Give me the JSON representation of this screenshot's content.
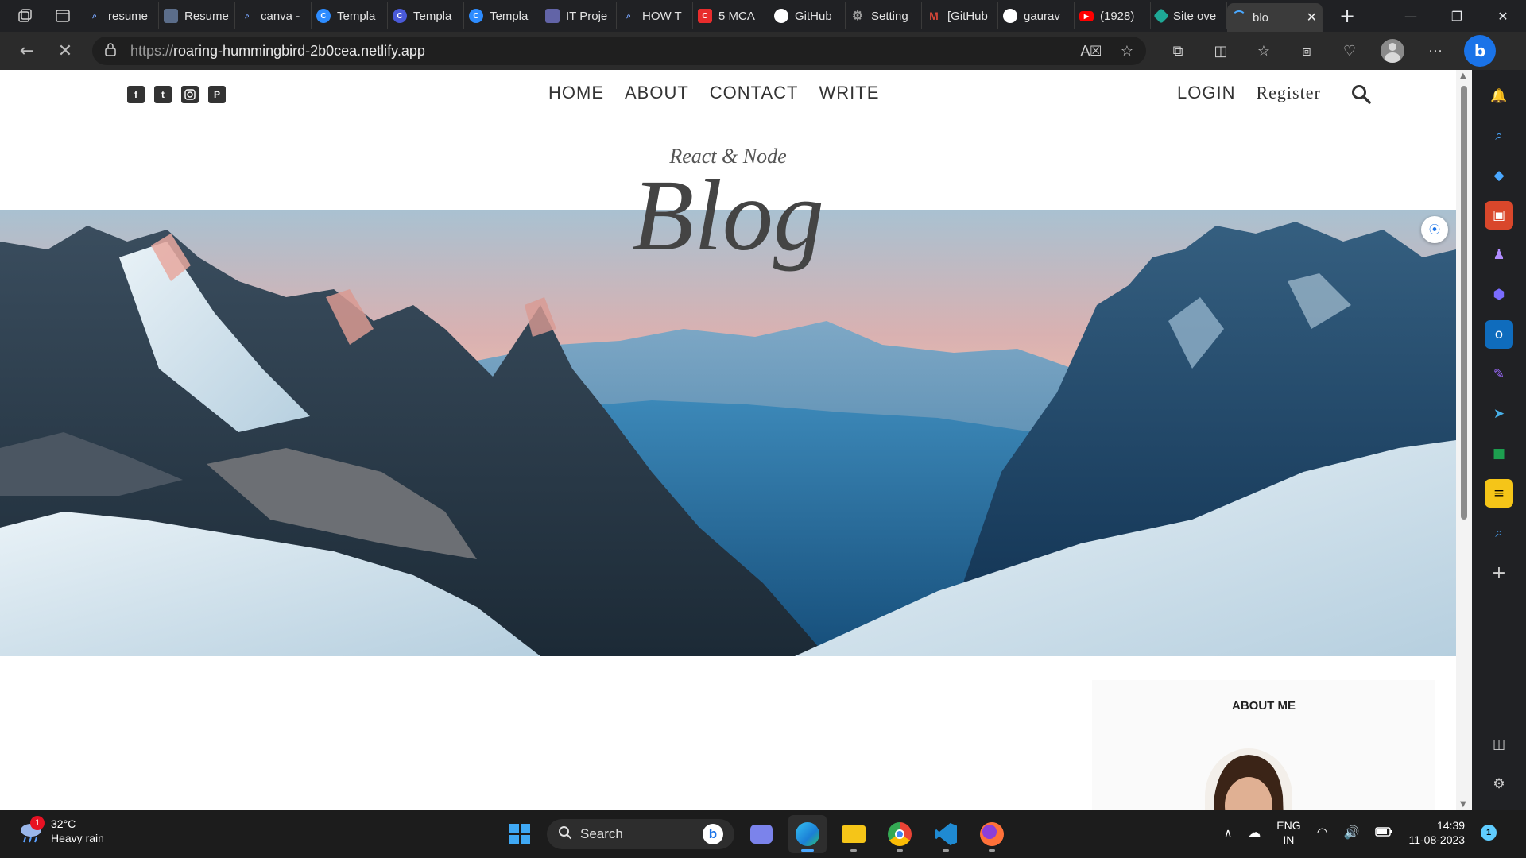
{
  "browser": {
    "tabs": [
      {
        "label": "resume",
        "icon": "search-icon",
        "color": "#3b3b3b"
      },
      {
        "label": "Resume",
        "icon": "document-icon",
        "color": "#5b6d8a"
      },
      {
        "label": "canva -",
        "icon": "search-icon",
        "color": "#3b3b3b"
      },
      {
        "label": "Templa",
        "icon": "canva-icon",
        "color": "#2d8cff"
      },
      {
        "label": "Templa",
        "icon": "canva-icon",
        "color": "#4a5ad8"
      },
      {
        "label": "Templa",
        "icon": "canva-icon",
        "color": "#2d8cff"
      },
      {
        "label": "IT Proje",
        "icon": "teams-icon",
        "color": "#6264a7"
      },
      {
        "label": "HOW T",
        "icon": "search-icon",
        "color": "#3b3b3b"
      },
      {
        "label": "5 MCA",
        "icon": "c-logo-icon",
        "color": "#e82c2c"
      },
      {
        "label": "GitHub",
        "icon": "github-icon",
        "color": "#ffffff"
      },
      {
        "label": "Setting",
        "icon": "gear-icon",
        "color": "#6b6b6b"
      },
      {
        "label": "[GitHub",
        "icon": "gmail-icon",
        "color": "#d44638"
      },
      {
        "label": "gaurav",
        "icon": "github-icon",
        "color": "#ffffff"
      },
      {
        "label": "(1928)",
        "icon": "youtube-icon",
        "color": "#ff0000"
      },
      {
        "label": "Site ove",
        "icon": "netlify-icon",
        "color": "#1ea896"
      },
      {
        "label": "blo",
        "icon": "loading-icon",
        "color": "#4aa8ff"
      }
    ],
    "url_prefix": "https://",
    "url_host": "roaring-hummingbird-2b0cea.netlify.app"
  },
  "blog": {
    "nav": [
      "HOME",
      "ABOUT",
      "CONTACT",
      "WRITE"
    ],
    "login": "LOGIN",
    "register": "Register",
    "subtitle": "React & Node",
    "title": "Blog",
    "about_title": "ABOUT ME"
  },
  "taskbar": {
    "weather_temp": "32°C",
    "weather_desc": "Heavy rain",
    "weather_badge": "1",
    "search_label": "Search",
    "lang_line1": "ENG",
    "lang_line2": "IN",
    "time": "14:39",
    "date": "11-08-2023",
    "notif_count": "1"
  }
}
